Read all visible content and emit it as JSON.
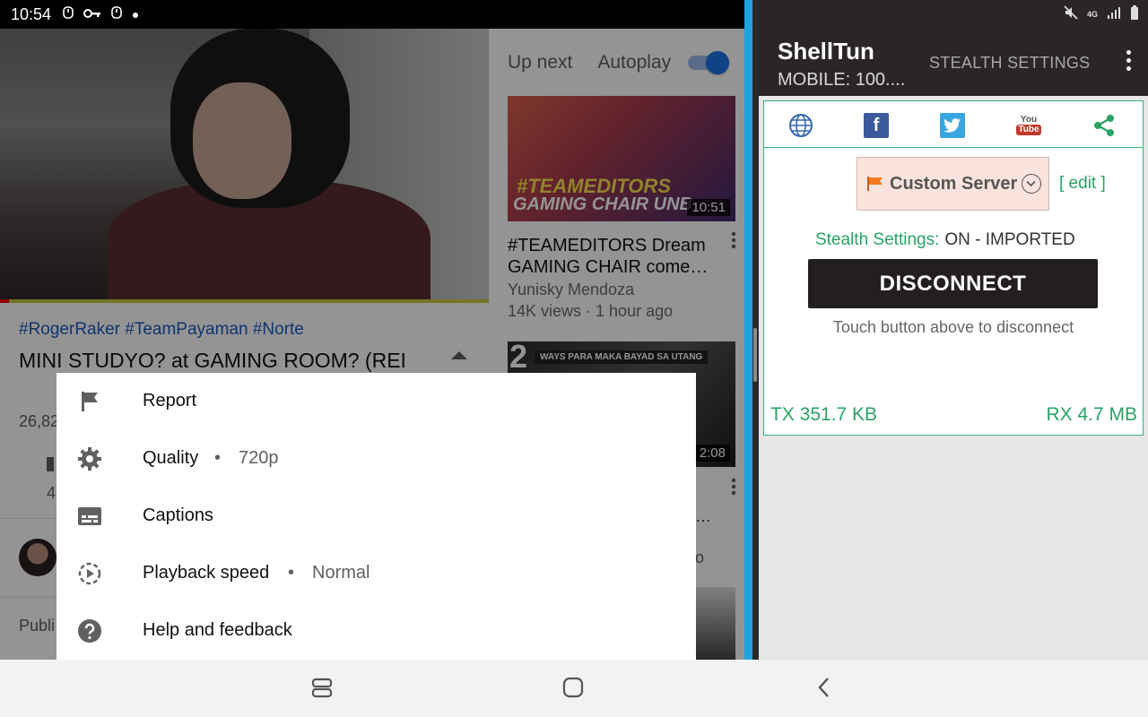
{
  "status_bar": {
    "time": "10:54"
  },
  "youtube": {
    "up_next_label": "Up next",
    "autoplay_label": "Autoplay",
    "autoplay_on": true,
    "hashtags": "#RogerRaker #TeamPayaman #Norte",
    "title": "MINI STUDYO? at GAMING ROOM? (REI",
    "views_partial": "26,82",
    "likes_partial": "4",
    "published_partial": "Publi",
    "recommendations": [
      {
        "thumb_text_1": "#TEAMEDITORS",
        "thumb_text_2": "GAMING CHAIR UNB",
        "duration": "10:51",
        "title": "#TEAMEDITORS Dream GAMING CHAIR come…",
        "channel": "Yunisky Mendoza",
        "stats": "14K views · 1 hour ago"
      },
      {
        "thumb_number": "2",
        "thumb_strip": "WAYS PARA MAKA BAYAD SA UTANG",
        "duration": "2:08",
        "title_partial": "…",
        "stats_partial": "o"
      }
    ],
    "menu": [
      {
        "icon": "flag-icon",
        "label": "Report"
      },
      {
        "icon": "gear-icon",
        "label": "Quality",
        "value": "720p"
      },
      {
        "icon": "captions-icon",
        "label": "Captions"
      },
      {
        "icon": "playback-speed-icon",
        "label": "Playback speed",
        "value": "Normal"
      },
      {
        "icon": "help-icon",
        "label": "Help and feedback"
      }
    ],
    "menu_separator": "•"
  },
  "shelltun": {
    "title": "ShellTun",
    "subtitle": "MOBILE: 100....",
    "stealth_settings_button": "STEALTH SETTINGS",
    "social_icons": [
      "globe-icon",
      "facebook-icon",
      "twitter-icon",
      "youtube-icon",
      "share-icon"
    ],
    "facebook_glyph": "f",
    "youtube_glyph_top": "You",
    "youtube_glyph_bottom": "Tube",
    "server_label": "Custom Server",
    "edit_label": "[ edit ]",
    "stealth_key": "Stealth Settings:",
    "stealth_value": "ON - IMPORTED",
    "disconnect_label": "DISCONNECT",
    "hint": "Touch button above to disconnect",
    "tx": "TX 351.7 KB",
    "rx": "RX 4.7 MB",
    "status_icons": [
      "mute-icon",
      "4g-icon",
      "signal-icon"
    ],
    "network_label": "4G"
  },
  "colors": {
    "accent_green": "#2aa365",
    "youtube_blue": "#1a73e8",
    "split_blue": "#1fa3e0",
    "dark_bar": "#2b2626"
  }
}
